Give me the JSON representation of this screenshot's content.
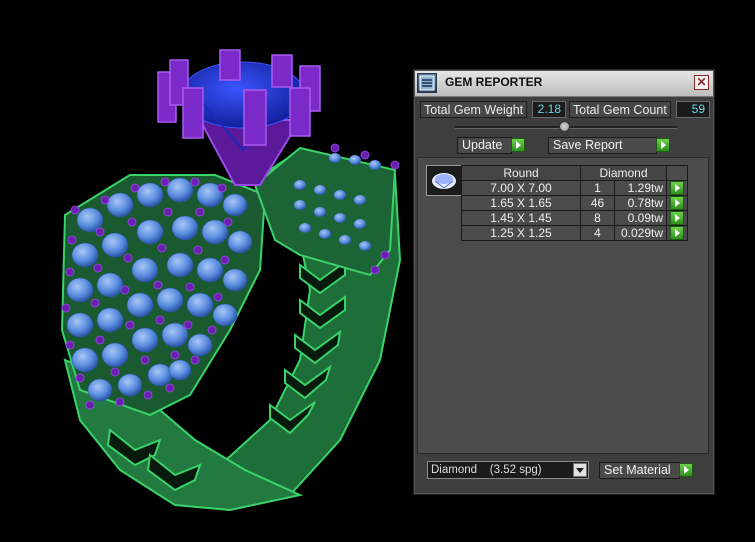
{
  "panel": {
    "title": "GEM REPORTER",
    "close_glyph": "✕",
    "total_gem_weight_label": "Total Gem Weight",
    "total_gem_weight_value": "2.18",
    "total_gem_count_label": "Total Gem Count",
    "total_gem_count_value": "59",
    "update_label": "Update",
    "save_report_label": "Save Report",
    "gem_cut_header": "Round",
    "gem_material_header": "Diamond",
    "rows": [
      {
        "size": "7.00 X 7.00",
        "count": "1",
        "weight": "1.29tw"
      },
      {
        "size": "1.65 X 1.65",
        "count": "46",
        "weight": "0.78tw"
      },
      {
        "size": "1.45 X 1.45",
        "count": "8",
        "weight": "0.09tw"
      },
      {
        "size": "1.25 X 1.25",
        "count": "4",
        "weight": "0.029tw"
      }
    ],
    "material_selected": "Diamond    (3.52 spg)",
    "set_material_label": "Set Material"
  },
  "colors": {
    "shank_green": "#3bd26a",
    "prong_purple": "#8a2bd6",
    "center_stone_blue": "#2235d8",
    "side_stone_blue": "#5b8fe0",
    "value_text_cyan": "#6fd2e6",
    "go_button_green": "#4fb834"
  },
  "icons": [
    "gem-reporter-icon",
    "close-icon",
    "play-arrow-icon",
    "gem-thumbnail-icon",
    "dropdown-arrow-icon"
  ]
}
